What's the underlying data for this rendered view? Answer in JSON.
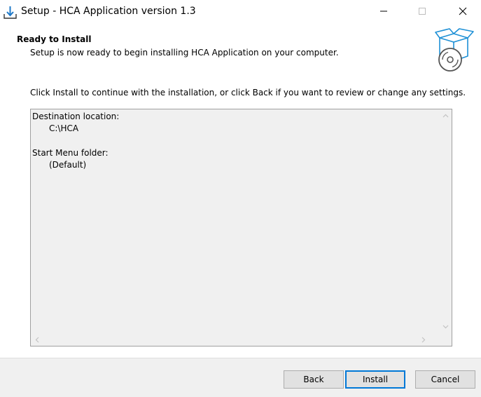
{
  "window": {
    "title": "Setup - HCA Application version 1.3",
    "icon": "setup-download-icon",
    "controls": [
      "minimize-icon",
      "maximize-icon",
      "close-icon"
    ]
  },
  "header": {
    "title": "Ready to Install",
    "subtitle": "Setup is now ready to begin installing HCA Application on your computer.",
    "image": "box-with-disc-icon"
  },
  "instruction": "Click Install to continue with the installation, or click Back if you want to review or change any settings.",
  "memo": {
    "destination_label": "Destination location:",
    "destination_value": "C:\\HCA",
    "start_menu_label": "Start Menu folder:",
    "start_menu_value": "(Default)"
  },
  "buttons": {
    "back": "Back",
    "install": "Install",
    "cancel": "Cancel"
  },
  "colors": {
    "accent": "#0078d7",
    "footer_bg": "#f0f0f0",
    "memo_bg": "#f0f0f0",
    "icon_blue": "#1e90d6"
  }
}
